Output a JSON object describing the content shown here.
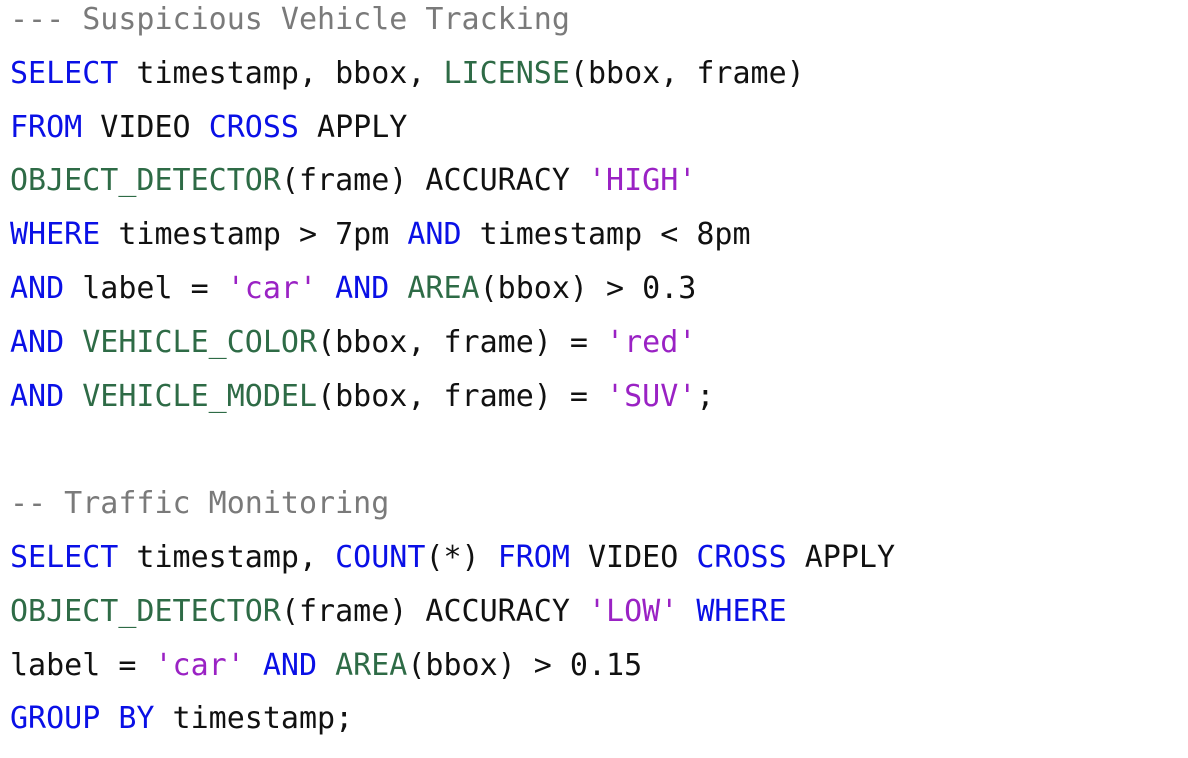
{
  "colors": {
    "keyword": "#0a10e6",
    "function": "#2e6b46",
    "string": "#9a22c4",
    "comment": "#7a7a7a",
    "text": "#111111",
    "background": "#ffffff"
  },
  "lines": [
    [
      {
        "t": "--- Suspicious Vehicle Tracking",
        "k": "cmt"
      }
    ],
    [
      {
        "t": "SELECT",
        "k": "kw"
      },
      {
        "t": " timestamp, bbox, ",
        "k": "txt"
      },
      {
        "t": "LICENSE",
        "k": "fn"
      },
      {
        "t": "(bbox, frame)",
        "k": "txt"
      }
    ],
    [
      {
        "t": "FROM",
        "k": "kw"
      },
      {
        "t": " VIDEO ",
        "k": "txt"
      },
      {
        "t": "CROSS",
        "k": "kw"
      },
      {
        "t": " APPLY",
        "k": "txt"
      }
    ],
    [
      {
        "t": "OBJECT_DETECTOR",
        "k": "fn"
      },
      {
        "t": "(frame) ACCURACY ",
        "k": "txt"
      },
      {
        "t": "'HIGH'",
        "k": "str"
      }
    ],
    [
      {
        "t": "WHERE",
        "k": "kw"
      },
      {
        "t": " timestamp > 7pm ",
        "k": "txt"
      },
      {
        "t": "AND",
        "k": "kw"
      },
      {
        "t": " timestamp < 8pm",
        "k": "txt"
      }
    ],
    [
      {
        "t": "AND",
        "k": "kw"
      },
      {
        "t": " label = ",
        "k": "txt"
      },
      {
        "t": "'car'",
        "k": "str"
      },
      {
        "t": " ",
        "k": "txt"
      },
      {
        "t": "AND",
        "k": "kw"
      },
      {
        "t": " ",
        "k": "txt"
      },
      {
        "t": "AREA",
        "k": "fn"
      },
      {
        "t": "(bbox) > 0.3",
        "k": "txt"
      }
    ],
    [
      {
        "t": "AND",
        "k": "kw"
      },
      {
        "t": " ",
        "k": "txt"
      },
      {
        "t": "VEHICLE_COLOR",
        "k": "fn"
      },
      {
        "t": "(bbox, frame) = ",
        "k": "txt"
      },
      {
        "t": "'red'",
        "k": "str"
      }
    ],
    [
      {
        "t": "AND",
        "k": "kw"
      },
      {
        "t": " ",
        "k": "txt"
      },
      {
        "t": "VEHICLE_MODEL",
        "k": "fn"
      },
      {
        "t": "(bbox, frame) = ",
        "k": "txt"
      },
      {
        "t": "'SUV'",
        "k": "str"
      },
      {
        "t": ";",
        "k": "txt"
      }
    ],
    [],
    [
      {
        "t": "-- Traffic Monitoring",
        "k": "cmt"
      }
    ],
    [
      {
        "t": "SELECT",
        "k": "kw"
      },
      {
        "t": " timestamp, ",
        "k": "txt"
      },
      {
        "t": "COUNT",
        "k": "kw"
      },
      {
        "t": "(*) ",
        "k": "txt"
      },
      {
        "t": "FROM",
        "k": "kw"
      },
      {
        "t": " VIDEO ",
        "k": "txt"
      },
      {
        "t": "CROSS",
        "k": "kw"
      },
      {
        "t": " APPLY",
        "k": "txt"
      }
    ],
    [
      {
        "t": "OBJECT_DETECTOR",
        "k": "fn"
      },
      {
        "t": "(frame) ACCURACY ",
        "k": "txt"
      },
      {
        "t": "'LOW'",
        "k": "str"
      },
      {
        "t": " ",
        "k": "txt"
      },
      {
        "t": "WHERE",
        "k": "kw"
      }
    ],
    [
      {
        "t": "label = ",
        "k": "txt"
      },
      {
        "t": "'car'",
        "k": "str"
      },
      {
        "t": " ",
        "k": "txt"
      },
      {
        "t": "AND",
        "k": "kw"
      },
      {
        "t": " ",
        "k": "txt"
      },
      {
        "t": "AREA",
        "k": "fn"
      },
      {
        "t": "(bbox) > 0.15",
        "k": "txt"
      }
    ],
    [
      {
        "t": "GROUP",
        "k": "kw"
      },
      {
        "t": " ",
        "k": "txt"
      },
      {
        "t": "BY",
        "k": "kw"
      },
      {
        "t": " timestamp;",
        "k": "txt"
      }
    ]
  ]
}
